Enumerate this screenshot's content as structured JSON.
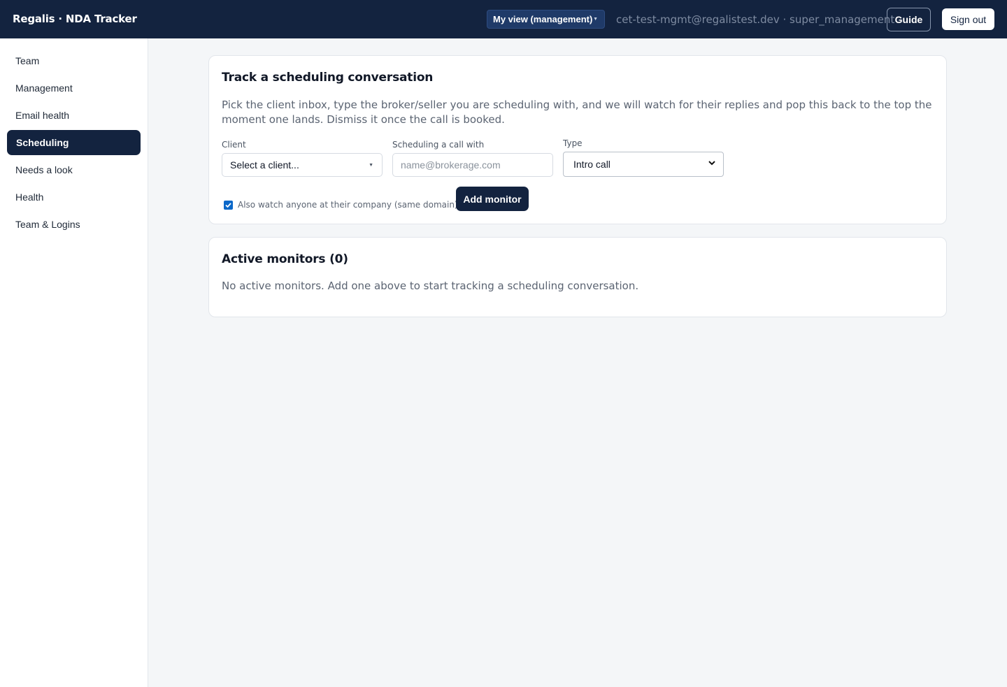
{
  "header": {
    "brand": "Regalis · NDA Tracker",
    "view_selector": "My view (management)",
    "user_info": "cet-test-mgmt@regalistest.dev · super_management",
    "guide_label": "Guide",
    "signout_label": "Sign out"
  },
  "sidebar": {
    "items": [
      {
        "label": "Team"
      },
      {
        "label": "Management"
      },
      {
        "label": "Email health"
      },
      {
        "label": "Scheduling",
        "active": true
      },
      {
        "label": "Needs a look"
      },
      {
        "label": "Health"
      },
      {
        "label": "Team & Logins"
      }
    ]
  },
  "track_card": {
    "title": "Track a scheduling conversation",
    "description": "Pick the client inbox, type the broker/seller you are scheduling with, and we will watch for their replies and pop this back to the top the moment one lands. Dismiss it once the call is booked.",
    "client_label": "Client",
    "client_value": "Select a client...",
    "contact_label": "Scheduling a call with",
    "contact_placeholder": "name@brokerage.com",
    "type_label": "Type",
    "type_value": "Intro call",
    "same_domain_label": "Also watch anyone at their company (same domain)",
    "same_domain_checked": true,
    "add_button": "Add monitor"
  },
  "monitors_card": {
    "title": "Active monitors (0)",
    "empty_message": "No active monitors. Add one above to start tracking a scheduling conversation."
  },
  "colors": {
    "navy": "#13233f",
    "checkbox_blue": "#0b68c9"
  }
}
